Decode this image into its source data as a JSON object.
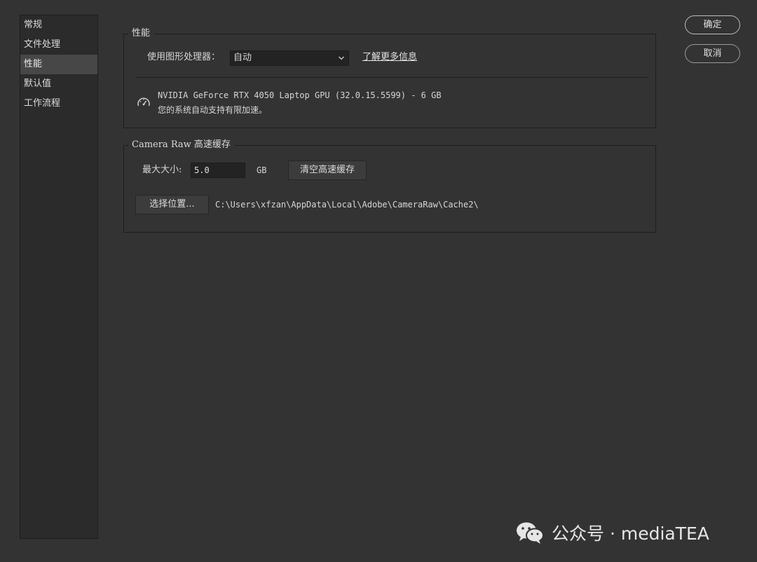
{
  "sidebar": {
    "items": [
      {
        "label": "常规",
        "selected": false
      },
      {
        "label": "文件处理",
        "selected": false
      },
      {
        "label": "性能",
        "selected": true
      },
      {
        "label": "默认值",
        "selected": false
      },
      {
        "label": "工作流程",
        "selected": false
      }
    ]
  },
  "performance": {
    "legend": "性能",
    "gpu_label": "使用图形处理器：",
    "gpu_select_value": "自动",
    "learn_more": "了解更多信息",
    "gpu_name": "NVIDIA GeForce RTX 4050 Laptop GPU (32.0.15.5599) - 6 GB",
    "gpu_status": "您的系统自动支持有限加速。",
    "gpu_icon": "speedometer-icon"
  },
  "cache": {
    "legend": "Camera Raw 高速缓存",
    "max_size_label": "最大大小:",
    "max_size_value": "5.0",
    "unit": "GB",
    "purge_button": "清空高速缓存",
    "choose_location_button": "选择位置...",
    "path": "C:\\Users\\xfzan\\AppData\\Local\\Adobe\\CameraRaw\\Cache2\\"
  },
  "actions": {
    "ok": "确定",
    "cancel": "取消"
  },
  "watermark": {
    "text": "公众号 · mediaTEA",
    "icon": "wechat-icon"
  }
}
